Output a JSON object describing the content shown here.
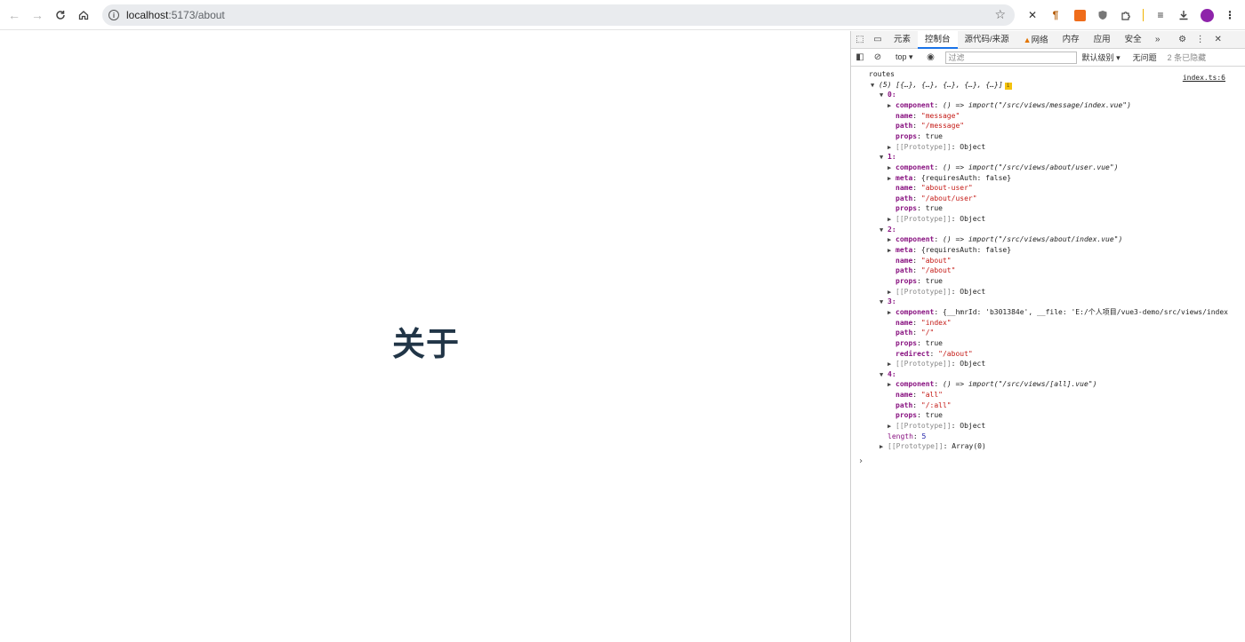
{
  "browser": {
    "url_host": "localhost",
    "url_rest": ":5173/about"
  },
  "page": {
    "heading": "关于"
  },
  "devtools": {
    "tabs": [
      "元素",
      "控制台",
      "源代码/来源",
      "网络",
      "内存",
      "应用",
      "安全"
    ],
    "active_tab": "控制台",
    "context": "top",
    "filter_placeholder": "过滤",
    "levels": "默认级别",
    "issues": "无问题",
    "hidden": "2 条已隐藏",
    "source_link": "index.ts:6"
  },
  "console": {
    "log_label": "routes",
    "array_summary": "(5) [{…}, {…}, {…}, {…}, {…}]",
    "info_badge": "i",
    "items": [
      {
        "index": "0:",
        "props": [
          {
            "expandable": true,
            "key": "component",
            "value": "() => import(\"/src/views/message/index.vue\")",
            "type": "fn"
          },
          {
            "expandable": false,
            "key": "name",
            "value": "\"message\"",
            "type": "str"
          },
          {
            "expandable": false,
            "key": "path",
            "value": "\"/message\"",
            "type": "str"
          },
          {
            "expandable": false,
            "key": "props",
            "value": "true",
            "type": "plain"
          },
          {
            "expandable": true,
            "key": "[[Prototype]]",
            "value": "Object",
            "type": "proto"
          }
        ]
      },
      {
        "index": "1:",
        "props": [
          {
            "expandable": true,
            "key": "component",
            "value": "() => import(\"/src/views/about/user.vue\")",
            "type": "fn"
          },
          {
            "expandable": true,
            "key": "meta",
            "value": "{requiresAuth: false}",
            "type": "plain"
          },
          {
            "expandable": false,
            "key": "name",
            "value": "\"about-user\"",
            "type": "str"
          },
          {
            "expandable": false,
            "key": "path",
            "value": "\"/about/user\"",
            "type": "str"
          },
          {
            "expandable": false,
            "key": "props",
            "value": "true",
            "type": "plain"
          },
          {
            "expandable": true,
            "key": "[[Prototype]]",
            "value": "Object",
            "type": "proto"
          }
        ]
      },
      {
        "index": "2:",
        "props": [
          {
            "expandable": true,
            "key": "component",
            "value": "() => import(\"/src/views/about/index.vue\")",
            "type": "fn"
          },
          {
            "expandable": true,
            "key": "meta",
            "value": "{requiresAuth: false}",
            "type": "plain"
          },
          {
            "expandable": false,
            "key": "name",
            "value": "\"about\"",
            "type": "str"
          },
          {
            "expandable": false,
            "key": "path",
            "value": "\"/about\"",
            "type": "str"
          },
          {
            "expandable": false,
            "key": "props",
            "value": "true",
            "type": "plain"
          },
          {
            "expandable": true,
            "key": "[[Prototype]]",
            "value": "Object",
            "type": "proto"
          }
        ]
      },
      {
        "index": "3:",
        "props": [
          {
            "expandable": true,
            "key": "component",
            "value": "{__hmrId: 'b301384e', __file: 'E:/个人项目/vue3-demo/src/views/index",
            "type": "plain"
          },
          {
            "expandable": false,
            "key": "name",
            "value": "\"index\"",
            "type": "str"
          },
          {
            "expandable": false,
            "key": "path",
            "value": "\"/\"",
            "type": "str"
          },
          {
            "expandable": false,
            "key": "props",
            "value": "true",
            "type": "plain"
          },
          {
            "expandable": false,
            "key": "redirect",
            "value": "\"/about\"",
            "type": "str"
          },
          {
            "expandable": true,
            "key": "[[Prototype]]",
            "value": "Object",
            "type": "proto"
          }
        ]
      },
      {
        "index": "4:",
        "props": [
          {
            "expandable": true,
            "key": "component",
            "value": "() => import(\"/src/views/[all].vue\")",
            "type": "fn"
          },
          {
            "expandable": false,
            "key": "name",
            "value": "\"all\"",
            "type": "str"
          },
          {
            "expandable": false,
            "key": "path",
            "value": "\"/:all\"",
            "type": "str"
          },
          {
            "expandable": false,
            "key": "props",
            "value": "true",
            "type": "plain"
          },
          {
            "expandable": true,
            "key": "[[Prototype]]",
            "value": "Object",
            "type": "proto"
          }
        ]
      }
    ],
    "length_key": "length",
    "length_value": "5",
    "array_proto_key": "[[Prototype]]",
    "array_proto_value": "Array(0)",
    "prompt": "›"
  },
  "colors": {
    "heading": "#213547",
    "active_tab": "#1a73e8",
    "key": "#881280",
    "string": "#c41a16"
  }
}
